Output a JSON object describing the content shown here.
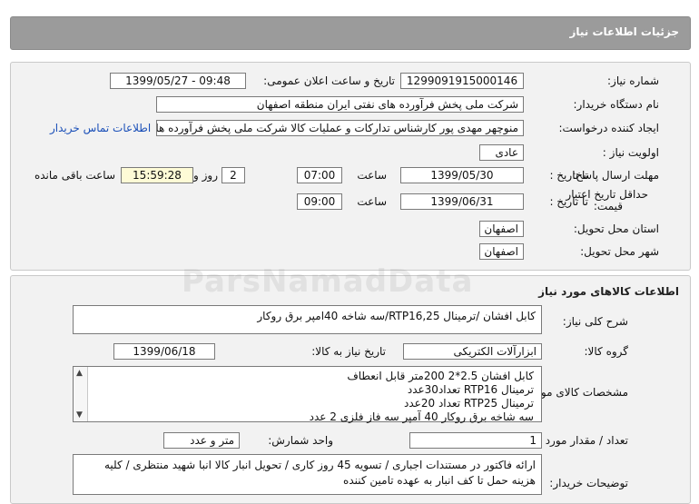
{
  "header": {
    "title": "جزئیات اطلاعات نیاز"
  },
  "details": {
    "need_number_label": "شماره نیاز:",
    "need_number": "1299091915000146",
    "announce_label": "تاریخ و ساعت اعلان عمومی:",
    "announce_value": "1399/05/27 - 09:48",
    "buyer_org_label": "نام دستگاه خریدار:",
    "buyer_org": "شرکت ملی پخش فرآورده های نفتی ایران منطقه اصفهان",
    "creator_label": "ایجاد کننده درخواست:",
    "creator": "منوچهر مهدی پور کارشناس تدارکات و عملیات کالا شرکت ملی پخش فرآورده های",
    "contact_link": "اطلاعات تماس خریدار",
    "priority_label": "اولویت نیاز :",
    "priority": "عادی",
    "reply_deadline_label": "مهلت ارسال پاسخ:",
    "to_date_label": "تا تاریخ :",
    "reply_date": "1399/05/30",
    "time_label": "ساعت",
    "reply_time": "07:00",
    "days_value": "2",
    "days_label": "روز و",
    "remaining_time": "15:59:28",
    "remaining_label": "ساعت باقی مانده",
    "price_validity_label_1": "حداقل تاریخ اعتبار",
    "price_validity_label_2": "قیمت:",
    "validity_to_label": "تا تاریخ :",
    "validity_date": "1399/06/31",
    "validity_time_label": "ساعت",
    "validity_time": "09:00",
    "province_label": "استان محل تحویل:",
    "province": "اصفهان",
    "city_label": "شهر محل تحویل:",
    "city": "اصفهان"
  },
  "goods": {
    "section_title": "اطلاعات کالاهای مورد نیاز",
    "summary_label": "شرح کلی نیاز:",
    "summary": "کابل افشان /ترمینال RTP16,25/سه شاخه 40امپر برق روکار",
    "group_label": "گروه کالا:",
    "group": "ابزارآلات الکتریکی",
    "need_date_label": "تاریخ نیاز به کالا:",
    "need_date": "1399/06/18",
    "specs_label": "مشخصات کالای مورد نیاز:",
    "specs_lines": [
      "کابل افشان 2.5*2    200متر  قابل انعطاف",
      "ترمینال RTP16       تعداد30عدد",
      "ترمینال RTP25     تعداد 20عدد",
      "سه شاخه برق روکار 40 آمپر سه فاز  فلزی 2 عدد"
    ],
    "count_label": "تعداد / مقدار مورد نیاز:",
    "count": "1",
    "unit_label": "واحد شمارش:",
    "unit": "متر و عدد",
    "buyer_notes_label": "توضیحات خریدار:",
    "buyer_notes": "ارائه فاکتور در مستندات اجباری / تسویه 45 روز کاری / تحویل انبار کالا انبا شهید منتظری / کلیه هزینه حمل تا کف انبار به عهده تامین کننده"
  },
  "watermark": "ParsNamadData"
}
